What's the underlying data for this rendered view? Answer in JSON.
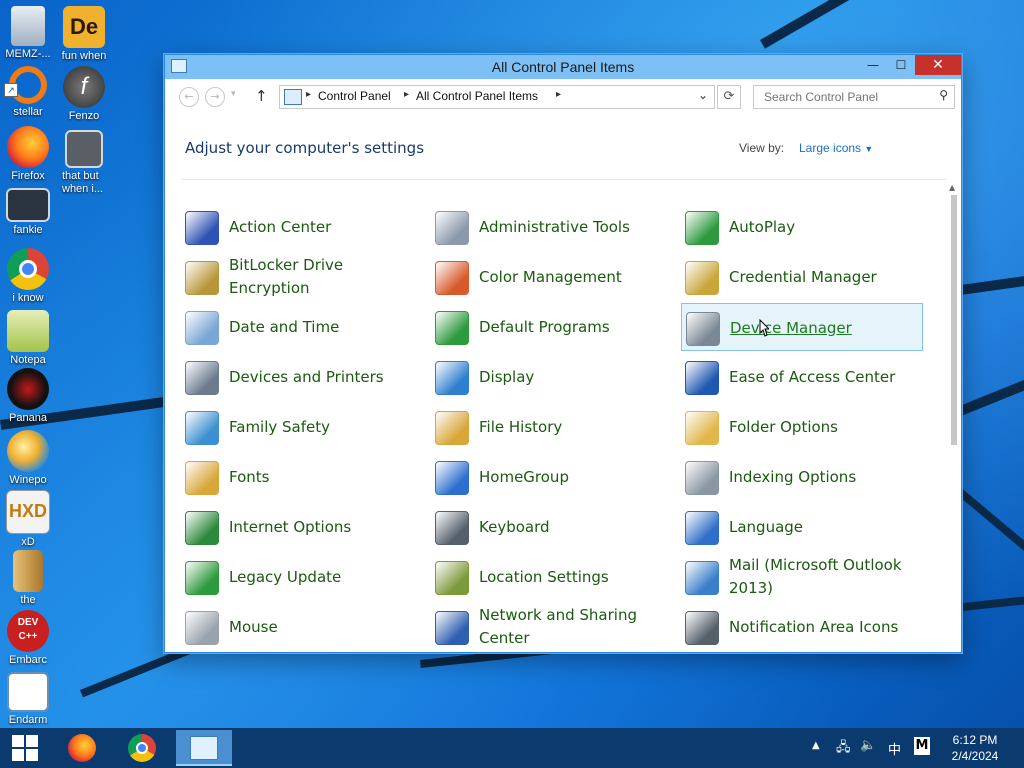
{
  "desktop": {
    "icons": [
      {
        "label": "MEMZ-...",
        "name": "recycle-bin-icon"
      },
      {
        "label": "fun when",
        "name": "de-app-icon"
      },
      {
        "label": "stellar",
        "name": "stellar-ring-icon"
      },
      {
        "label": "Fenzo",
        "name": "flash-icon"
      },
      {
        "label": "Firefox",
        "name": "firefox-icon"
      },
      {
        "label": "that but when i...",
        "name": "windows-stack-icon"
      },
      {
        "label": "fankie",
        "name": "computer-gears-icon"
      },
      {
        "label": "i know",
        "name": "chrome-icon"
      },
      {
        "label": "Notepa",
        "name": "notepad-icon"
      },
      {
        "label": "Panana",
        "name": "panana-app-icon"
      },
      {
        "label": "Winepo",
        "name": "winepo-app-icon"
      },
      {
        "label": "xD",
        "name": "hxd-icon"
      },
      {
        "label": "the",
        "name": "music-file-icon"
      },
      {
        "label": "Embarc",
        "name": "dev-cpp-icon"
      },
      {
        "label": "Endarm",
        "name": "document-window-icon"
      }
    ]
  },
  "window": {
    "title": "All Control Panel Items",
    "address": {
      "crumbs": [
        "Control Panel",
        "All Control Panel Items"
      ]
    },
    "search_placeholder": "Search Control Panel",
    "heading": "Adjust your computer's settings",
    "view_by_label": "View by:",
    "view_by_value": "Large icons",
    "items": [
      {
        "label": "Action Center",
        "icon": "flag-icon",
        "color": "#2e53b4"
      },
      {
        "label": "Administrative Tools",
        "icon": "admin-tools-icon",
        "color": "#8a9aab"
      },
      {
        "label": "AutoPlay",
        "icon": "autoplay-icon",
        "color": "#2c9a3d"
      },
      {
        "label": "BitLocker Drive Encryption",
        "icon": "bitlocker-keys-icon",
        "color": "#b8973a"
      },
      {
        "label": "Color Management",
        "icon": "color-management-icon",
        "color": "#d85a2a"
      },
      {
        "label": "Credential Manager",
        "icon": "credential-safe-icon",
        "color": "#c9a53a"
      },
      {
        "label": "Date and Time",
        "icon": "calendar-clock-icon",
        "color": "#7aa6d6"
      },
      {
        "label": "Default Programs",
        "icon": "default-programs-icon",
        "color": "#2c9a3d"
      },
      {
        "label": "Device Manager",
        "icon": "device-manager-icon",
        "color": "#7a8794"
      },
      {
        "label": "Devices and Printers",
        "icon": "printer-icon",
        "color": "#6b7b8c"
      },
      {
        "label": "Display",
        "icon": "monitor-icon",
        "color": "#2f7fcf"
      },
      {
        "label": "Ease of Access Center",
        "icon": "ease-of-access-icon",
        "color": "#1f58b0"
      },
      {
        "label": "Family Safety",
        "icon": "family-safety-icon",
        "color": "#3c8fd0"
      },
      {
        "label": "File History",
        "icon": "file-history-icon",
        "color": "#d9a63a"
      },
      {
        "label": "Folder Options",
        "icon": "folder-options-icon",
        "color": "#e1b64a"
      },
      {
        "label": "Fonts",
        "icon": "fonts-folder-icon",
        "color": "#d9a63a"
      },
      {
        "label": "HomeGroup",
        "icon": "homegroup-icon",
        "color": "#2c6fd0"
      },
      {
        "label": "Indexing Options",
        "icon": "indexing-magnifier-icon",
        "color": "#8a96a3"
      },
      {
        "label": "Internet Options",
        "icon": "internet-options-icon",
        "color": "#2c8a3d"
      },
      {
        "label": "Keyboard",
        "icon": "keyboard-icon",
        "color": "#55606b"
      },
      {
        "label": "Language",
        "icon": "language-icon",
        "color": "#2f6fc9"
      },
      {
        "label": "Legacy Update",
        "icon": "legacy-update-icon",
        "color": "#2c9a3d"
      },
      {
        "label": "Location Settings",
        "icon": "location-settings-icon",
        "color": "#7d9a3a"
      },
      {
        "label": "Mail (Microsoft Outlook 2013)",
        "icon": "mail-icon",
        "color": "#3a7fc9"
      },
      {
        "label": "Mouse",
        "icon": "mouse-icon",
        "color": "#9aa3ad"
      },
      {
        "label": "Network and Sharing Center",
        "icon": "network-icon",
        "color": "#2f5fb0"
      },
      {
        "label": "Notification Area Icons",
        "icon": "notification-area-icon",
        "color": "#55606b"
      }
    ],
    "selected_item": "Device Manager"
  },
  "taskbar": {
    "apps": [
      {
        "name": "firefox-taskbar-icon"
      },
      {
        "name": "chrome-taskbar-icon"
      },
      {
        "name": "control-panel-taskbar-icon"
      }
    ],
    "tray_ime": "中",
    "tray_m": "M",
    "time": "6:12 PM",
    "date": "2/4/2024"
  },
  "colors": {
    "accent": "#1a6fd0",
    "item_text": "#1a5b0f",
    "heading": "#1a3a6e",
    "close_button": "#c7312b"
  }
}
